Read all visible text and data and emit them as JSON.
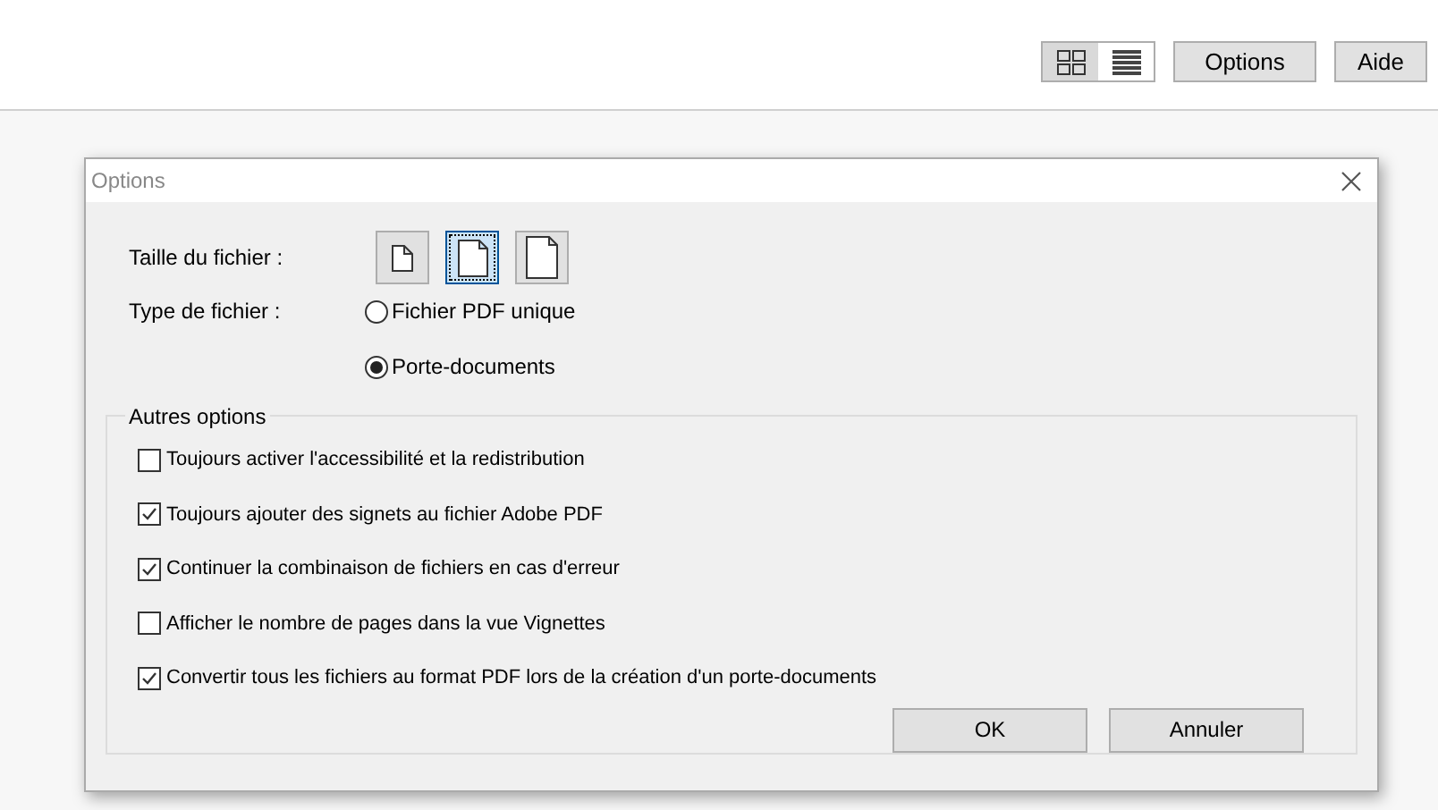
{
  "toolbar": {
    "views": [
      {
        "kind": "grid",
        "selected": true
      },
      {
        "kind": "list",
        "selected": false
      }
    ],
    "buttons": [
      "Options",
      "Aide"
    ]
  },
  "dialog": {
    "title": "Options",
    "file_size": {
      "label": "Taille du fichier :",
      "options": [
        {
          "kind": "small",
          "selected": false
        },
        {
          "kind": "medium",
          "selected": true
        },
        {
          "kind": "large",
          "selected": false
        }
      ]
    },
    "file_type": {
      "label": "Type de fichier :",
      "options": [
        {
          "label": "Fichier PDF unique",
          "selected": false
        },
        {
          "label": "Porte-documents",
          "selected": true
        }
      ]
    },
    "other": {
      "title": "Autres options",
      "items": [
        {
          "label": "Toujours activer l'accessibilité et la redistribution",
          "checked": false
        },
        {
          "label": "Toujours ajouter des signets au fichier Adobe PDF",
          "checked": true
        },
        {
          "label": "Continuer la combinaison de fichiers en cas d'erreur",
          "checked": true
        },
        {
          "label": "Afficher le nombre de pages dans la vue Vignettes",
          "checked": false
        },
        {
          "label": "Convertir tous les fichiers au format PDF lors de la création d'un porte-documents",
          "checked": true
        }
      ]
    },
    "buttons": [
      "OK",
      "Annuler"
    ]
  }
}
